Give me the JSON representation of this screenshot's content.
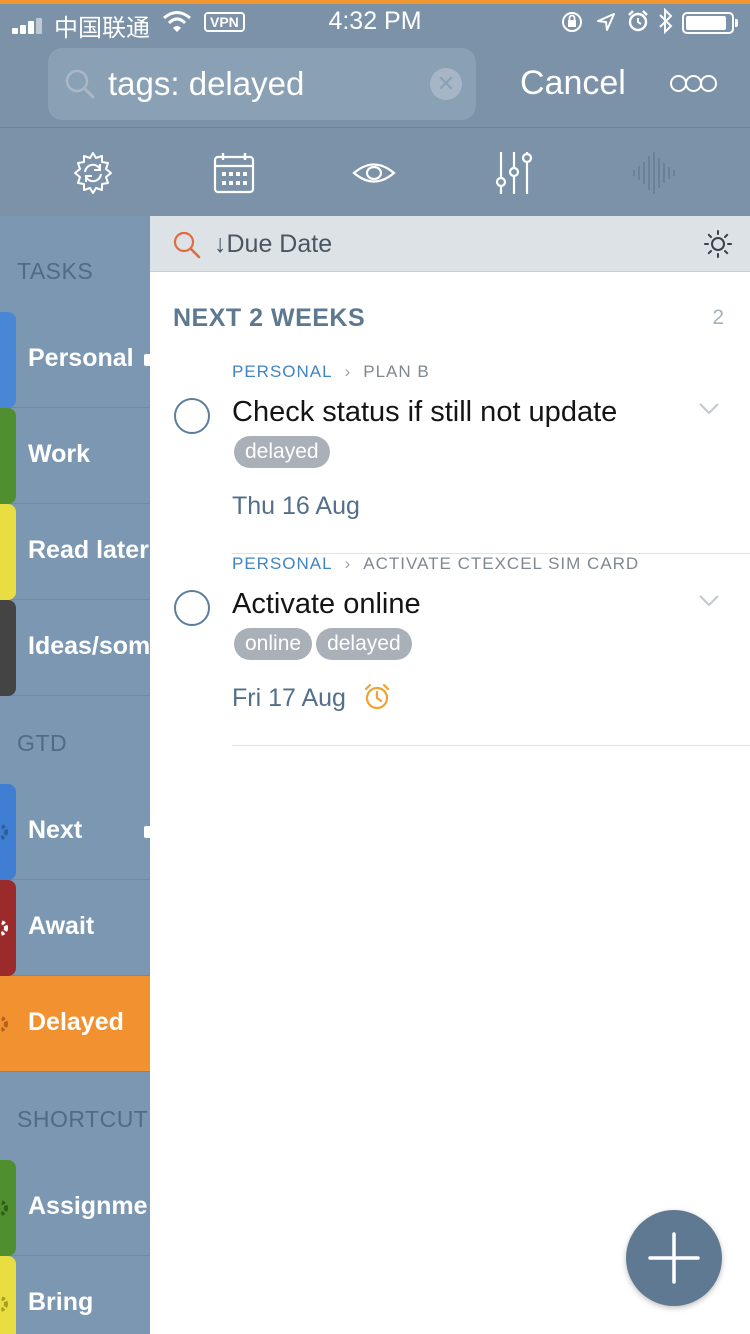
{
  "status_bar": {
    "carrier": "中国联通",
    "vpn": "VPN",
    "time": "4:32 PM"
  },
  "search": {
    "query": "tags: delayed",
    "cancel_label": "Cancel"
  },
  "toolbar_icons": [
    "sync-icon",
    "calendar-icon",
    "eye-icon",
    "sliders-icon",
    "waveform-icon"
  ],
  "sidebar": {
    "sections": [
      {
        "title": "TASKS",
        "items": [
          {
            "label": "Personal",
            "color": "#4a86d6",
            "dot": true
          },
          {
            "label": "Work",
            "color": "#4f8f2f"
          },
          {
            "label": "Read later",
            "color": "#e8de42"
          },
          {
            "label": "Ideas/som",
            "color": "#444444"
          }
        ]
      },
      {
        "title": "GTD",
        "items": [
          {
            "label": "Next",
            "color": "#3f7ed3",
            "dot": true
          },
          {
            "label": "Await",
            "color": "#9b2b2b"
          },
          {
            "label": "Delayed",
            "color": "#f2912f",
            "active": true
          }
        ]
      },
      {
        "title": "SHORTCUT",
        "items": [
          {
            "label": "Assignme",
            "color": "#4f8f2f"
          },
          {
            "label": "Bring",
            "color": "#e8de42"
          }
        ]
      }
    ]
  },
  "sort": {
    "label": "↓Due Date"
  },
  "group": {
    "title": "NEXT 2 WEEKS",
    "count": "2"
  },
  "tasks": [
    {
      "project": "PERSONAL",
      "separator": "›",
      "parent": "PLAN B",
      "title": "Check status if still not update",
      "tags": [
        "delayed"
      ],
      "due": "Thu 16 Aug",
      "alarm": false
    },
    {
      "project": "PERSONAL",
      "separator": "›",
      "parent": "ACTIVATE CTEXCEL SIM CARD",
      "title": "Activate online",
      "tags": [
        "online",
        "delayed"
      ],
      "due": "Fri 17 Aug",
      "alarm": true
    }
  ],
  "colors": {
    "header": "#7c92a8",
    "sidebar": "#7c97b2",
    "accent": "#f2912f",
    "fab": "#5f7993"
  }
}
